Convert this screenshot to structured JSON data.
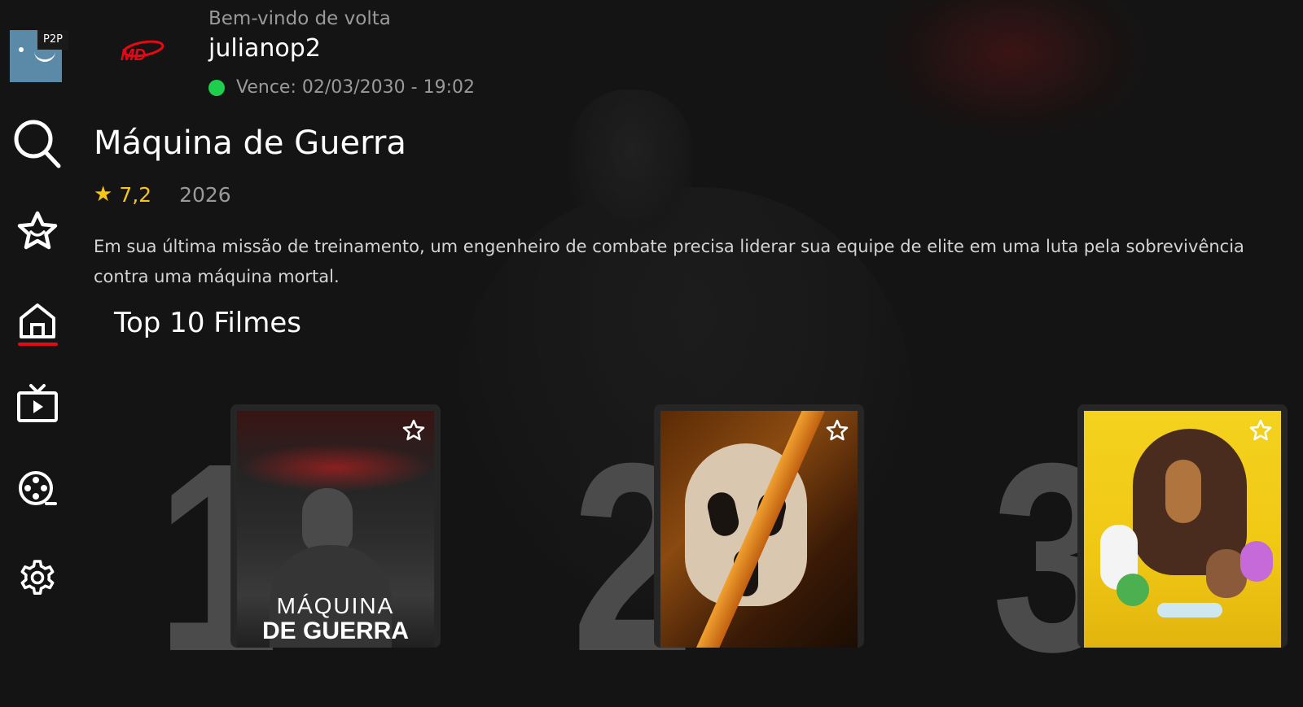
{
  "sidebar": {
    "badge": "P2P",
    "items": [
      {
        "name": "search",
        "icon": "search-icon"
      },
      {
        "name": "favorites",
        "icon": "star-face-icon"
      },
      {
        "name": "home",
        "icon": "home-icon",
        "active": true
      },
      {
        "name": "live-tv",
        "icon": "tv-icon"
      },
      {
        "name": "movies",
        "icon": "film-reel-icon"
      },
      {
        "name": "settings",
        "icon": "gear-icon"
      }
    ],
    "active_color": "#e50914"
  },
  "header": {
    "welcome": "Bem-vindo de volta",
    "username": "julianop2",
    "expiry": "Vence: 02/03/2030 - 19:02",
    "status_color": "#1fce4c"
  },
  "hero": {
    "title": "Máquina de Guerra",
    "rating": "7,2",
    "year": "2026",
    "description": "Em sua última missão de treinamento, um engenheiro de combate precisa liderar sua equipe de elite em uma luta pela sobrevivência contra uma máquina mortal.",
    "rating_color": "#f5c518"
  },
  "top10": {
    "title": "Top 10 Filmes",
    "items": [
      {
        "rank": "1",
        "poster_line1": "MÁQUINA",
        "poster_line2": "DE GUERRA"
      },
      {
        "rank": "2"
      },
      {
        "rank": "3"
      }
    ]
  }
}
